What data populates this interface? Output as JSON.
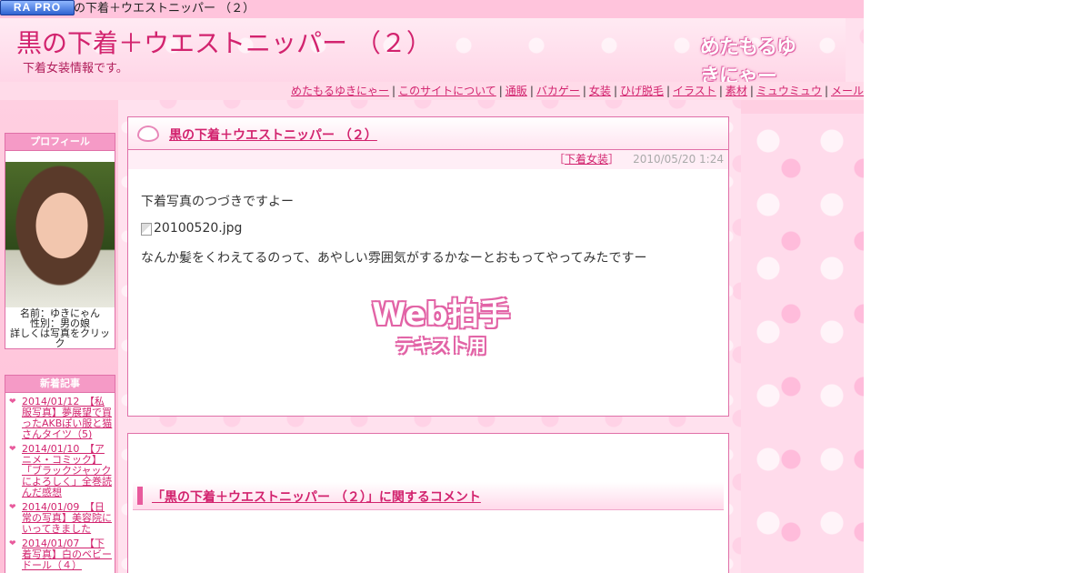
{
  "topbar": {
    "badge": "RA PRO",
    "title": "黒の下着＋ウエストニッパー （２）"
  },
  "header": {
    "title": "黒の下着＋ウエストニッパー （２）",
    "subtitle": "下着女装情報です。",
    "logo_text": "めたもるゆきにゃー"
  },
  "nav": {
    "items": [
      "めたもるゆきにゃー",
      "このサイトについて",
      "通販",
      "バカゲー",
      "女装",
      "ひげ脱毛",
      "イラスト",
      "素材",
      "ミュウミュウ",
      "メール"
    ],
    "separator": "|"
  },
  "sidebar": {
    "profile": {
      "heading": "プロフィール",
      "name": "名前：ゆきにゃん",
      "gender": "性別：男の娘",
      "detail": "詳しくは写真をクリック"
    },
    "news": {
      "heading": "新着記事",
      "items": [
        "2014/01/12　【私服写真】夢展望で買ったAKBぽい服と猫さんタイツ（5)",
        "2014/01/10　【アニメ・コミック】「ブラックジャックによろしく」全巻読んだ感想",
        "2014/01/09　【日常の写真】美容院にいってきました",
        "2014/01/07　【下着写真】白のベビードール（４）"
      ]
    }
  },
  "post": {
    "title": "黒の下着＋ウエストニッパー （２）",
    "category_open": "［",
    "category": "下着女装",
    "category_close": "］",
    "date": "2010/05/20 1:24",
    "line1": "下着写真のつづきですよー",
    "image_alt": "20100520.jpg",
    "line2": "なんか髪をくわえてるのって、あやしい雰囲気がするかなーとおもってやってみたですー",
    "clap_top": "Web拍手",
    "clap_bottom": "テキスト用"
  },
  "comments": {
    "title": "「黒の下着＋ウエストニッパー （２）」に関するコメント"
  },
  "colors": {
    "accent": "#d2236e",
    "pink_bg": "#ffe1ee",
    "box_border": "#e070a8"
  }
}
